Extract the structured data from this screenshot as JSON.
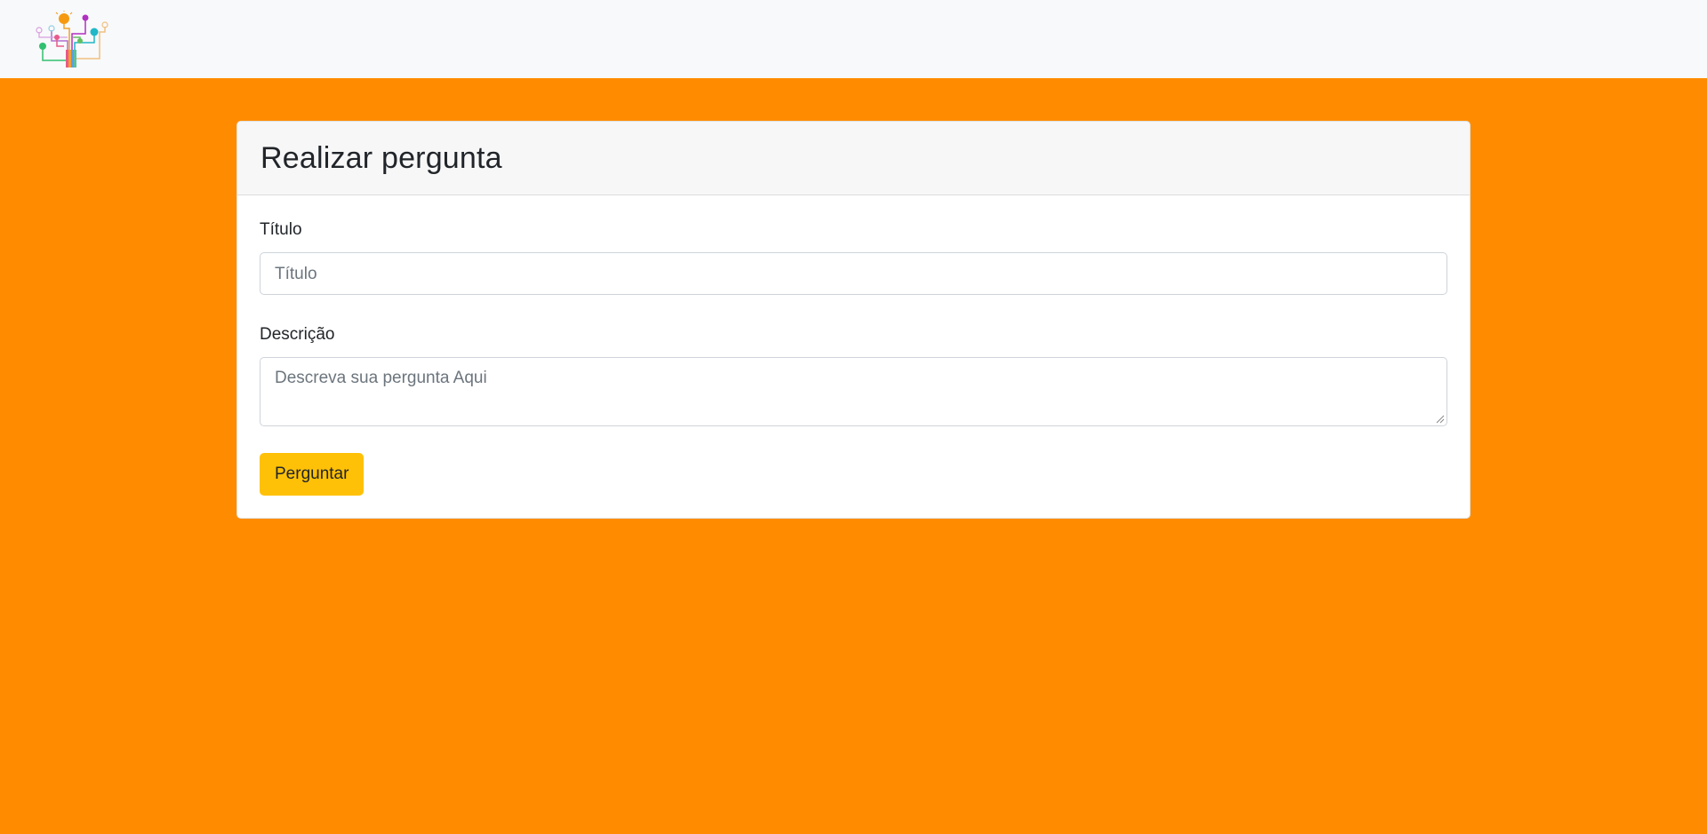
{
  "page": {
    "background_color": "#ff8c00"
  },
  "navbar": {
    "logo_icon": "lightbulb-tree-logo-icon",
    "background_color": "#f8f9fa"
  },
  "form": {
    "title": "Realizar pergunta",
    "titulo_label": "Título",
    "titulo_placeholder": "Título",
    "descricao_label": "Descrição",
    "descricao_placeholder": "Descreva sua pergunta Aqui",
    "submit_label": "Perguntar",
    "submit_color": "#ffc107"
  }
}
